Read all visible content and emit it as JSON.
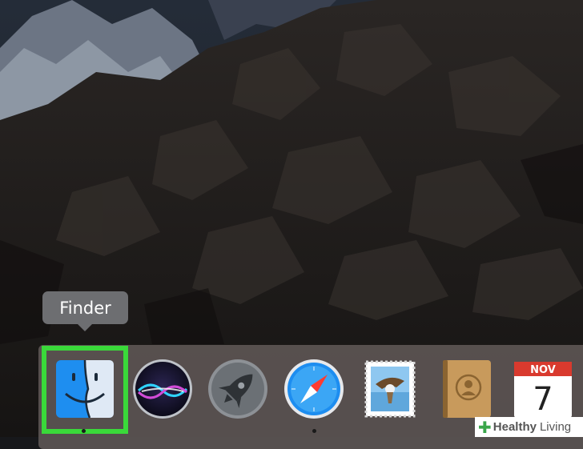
{
  "tooltip": {
    "label": "Finder"
  },
  "dock": {
    "items": [
      {
        "name": "Finder",
        "icon": "finder-icon"
      },
      {
        "name": "Siri",
        "icon": "siri-icon"
      },
      {
        "name": "Launchpad",
        "icon": "launchpad-icon"
      },
      {
        "name": "Safari",
        "icon": "safari-icon"
      },
      {
        "name": "Mail",
        "icon": "mail-icon"
      },
      {
        "name": "Contacts",
        "icon": "contacts-icon"
      },
      {
        "name": "Calendar",
        "icon": "calendar-icon"
      }
    ]
  },
  "calendar": {
    "month": "NOV",
    "day": "7"
  },
  "watermark": {
    "brand": "Healthy",
    "suffix": "Living"
  },
  "colors": {
    "highlight": "#3ad93a",
    "dock": "#605856",
    "tooltip": "#6d6e71",
    "calendar_red": "#d93a2e"
  }
}
